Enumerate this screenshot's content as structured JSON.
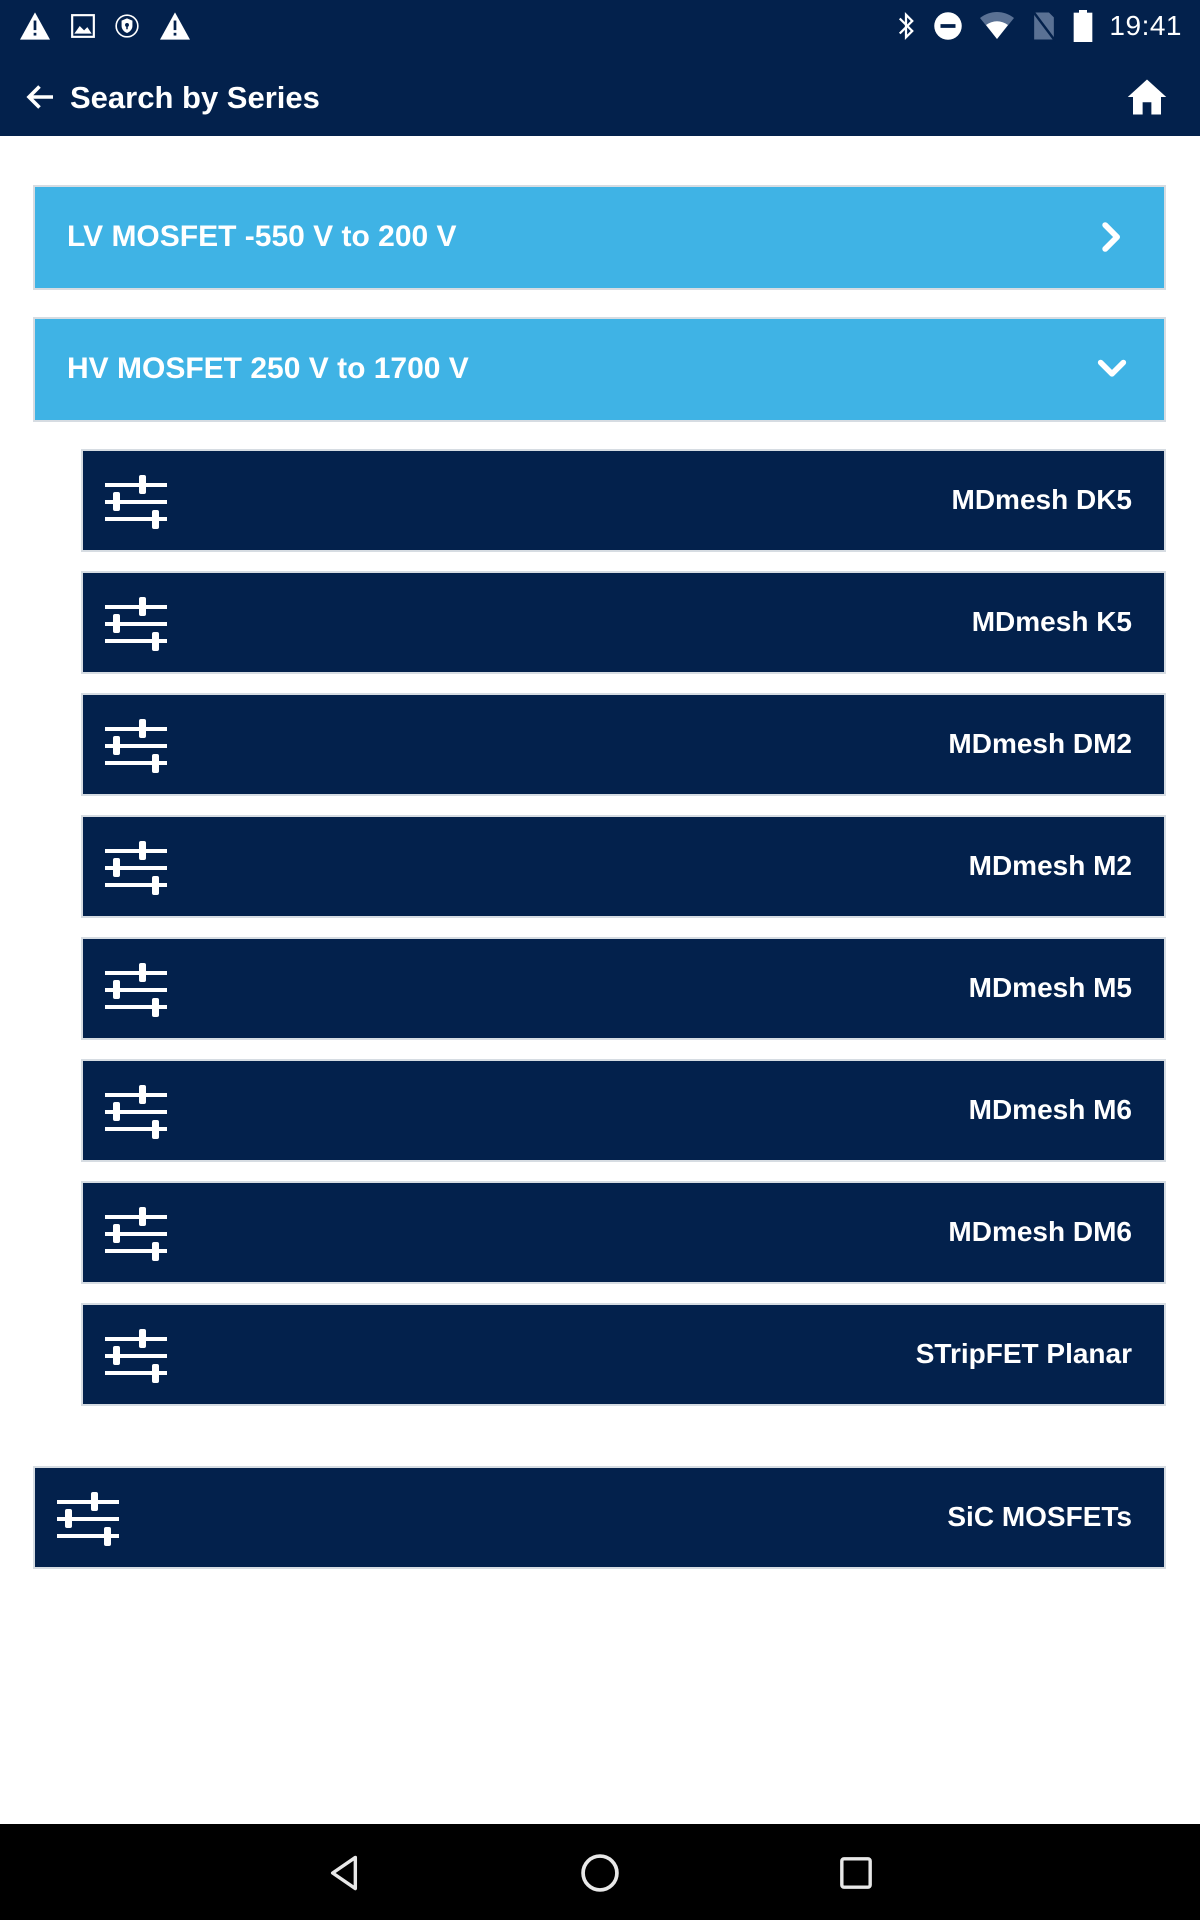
{
  "status_bar": {
    "left_icons": [
      "warning-icon",
      "image-icon",
      "vpn-shield-icon",
      "warning-icon"
    ],
    "right_icons": [
      "bluetooth-icon",
      "do-not-disturb-icon",
      "wifi-icon",
      "no-sim-icon",
      "battery-icon"
    ],
    "time": "19:41"
  },
  "app_bar": {
    "back_icon": "arrow-back-icon",
    "title": "Search by Series",
    "home_icon": "home-icon"
  },
  "categories": [
    {
      "label": "LV MOSFET -550 V to 200 V",
      "expanded": false,
      "chevron_icon": "chevron-right-icon"
    },
    {
      "label": "HV MOSFET 250 V to 1700 V",
      "expanded": true,
      "chevron_icon": "chevron-down-icon",
      "series": [
        {
          "label": "MDmesh DK5",
          "icon": "sliders-icon"
        },
        {
          "label": "MDmesh K5",
          "icon": "sliders-icon"
        },
        {
          "label": "MDmesh DM2",
          "icon": "sliders-icon"
        },
        {
          "label": "MDmesh M2",
          "icon": "sliders-icon"
        },
        {
          "label": "MDmesh M5",
          "icon": "sliders-icon"
        },
        {
          "label": "MDmesh M6",
          "icon": "sliders-icon"
        },
        {
          "label": "MDmesh DM6",
          "icon": "sliders-icon"
        },
        {
          "label": "STripFET Planar",
          "icon": "sliders-icon"
        }
      ]
    }
  ],
  "top_level_series": {
    "label": "SiC MOSFETs",
    "icon": "sliders-icon"
  },
  "nav_bar": {
    "buttons": [
      "back-triangle-icon",
      "home-circle-icon",
      "recents-square-icon"
    ]
  },
  "colors": {
    "primary_dark": "#03214c",
    "accent_blue": "#3fb3e5",
    "border": "#d6dce2",
    "background": "#ffffff",
    "nav_bar": "#000000"
  }
}
